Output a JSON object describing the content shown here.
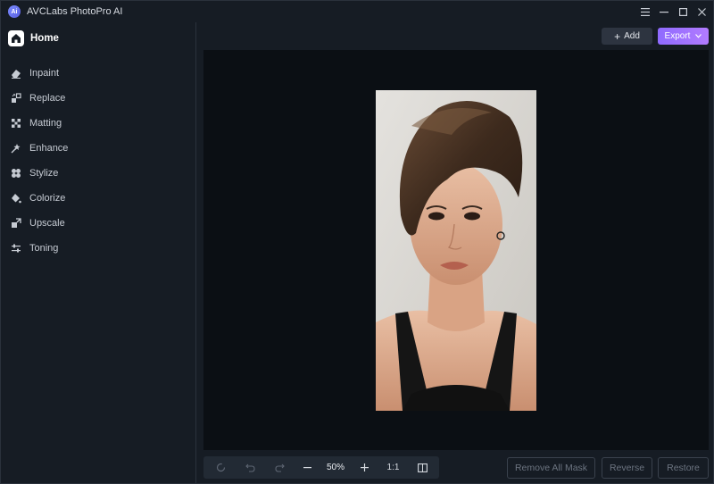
{
  "app": {
    "title": "AVCLabs PhotoPro AI",
    "logo_text": "Ai",
    "accent": "#9b70ff"
  },
  "window_controls": {
    "menu_icon": "hamburger-icon",
    "minimize_icon": "minimize-icon",
    "maximize_icon": "maximize-icon",
    "close_icon": "close-icon"
  },
  "sidebar": {
    "home": {
      "label": "Home",
      "icon": "home-icon"
    },
    "items": [
      {
        "label": "Inpaint",
        "icon": "eraser-icon"
      },
      {
        "label": "Replace",
        "icon": "replace-icon"
      },
      {
        "label": "Matting",
        "icon": "matting-icon"
      },
      {
        "label": "Enhance",
        "icon": "enhance-icon"
      },
      {
        "label": "Stylize",
        "icon": "stylize-icon"
      },
      {
        "label": "Colorize",
        "icon": "colorize-icon"
      },
      {
        "label": "Upscale",
        "icon": "upscale-icon"
      },
      {
        "label": "Toning",
        "icon": "toning-icon"
      }
    ]
  },
  "header": {
    "add_label": "Add",
    "export_label": "Export"
  },
  "toolbar": {
    "zoom": "50%",
    "ratio": "1:1"
  },
  "actions": {
    "remove_all_mask": "Remove All Mask",
    "reverse": "Reverse",
    "restore": "Restore"
  }
}
